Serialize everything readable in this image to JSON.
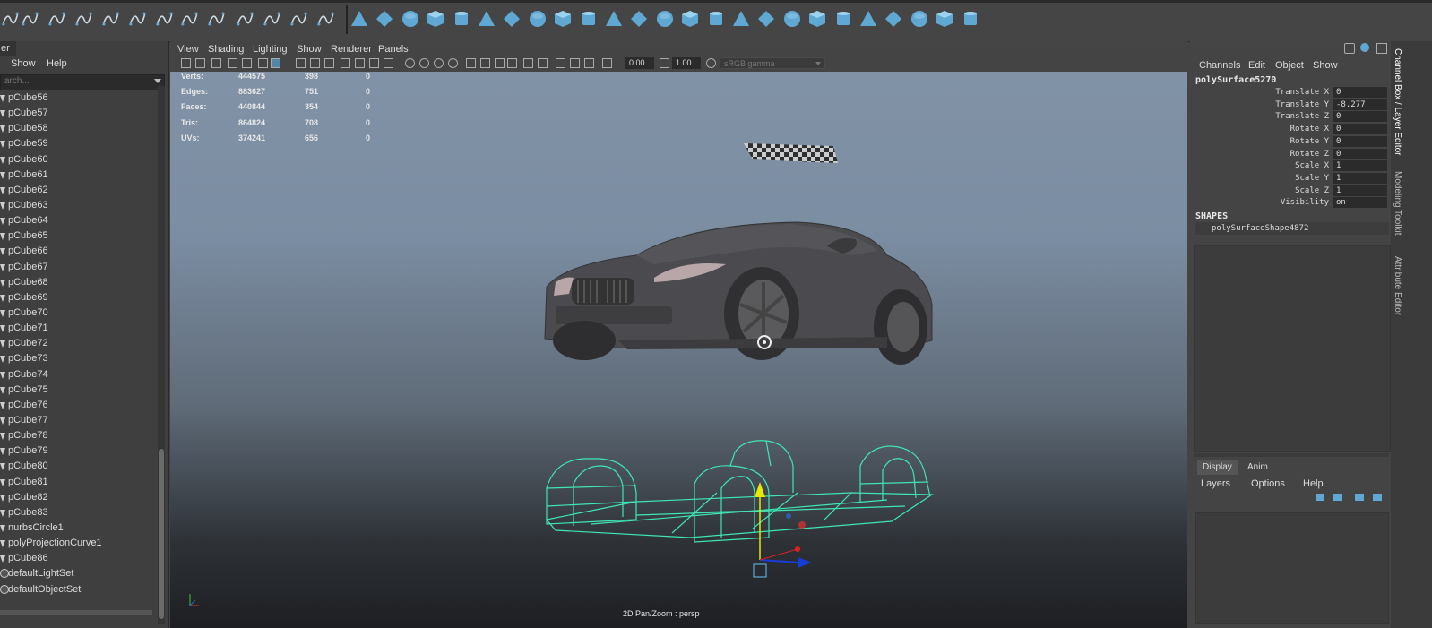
{
  "shelf": {
    "icons": [
      "select-curve-icon",
      "ep-curve-icon",
      "pencil-curve-icon",
      "bezier-curve-icon",
      "arc-icon",
      "curve-bend-icon",
      "curve-tool-icon",
      "curve-spiral-icon",
      "curve-zigzag-icon",
      "circle-arc-icon",
      "curve-points-icon",
      "curve-stroke-icon",
      "curve-rebuild-icon",
      "curve-edit-icon",
      "sphere-icon",
      "cube-icon",
      "cylinder-icon",
      "cone-icon",
      "plane-icon",
      "torus-icon",
      "pipe-icon",
      "helix-icon",
      "sphere-platonic-icon",
      "nurbs-cylinder-icon",
      "nurbs-plane-icon",
      "cube-open-icon",
      "cube-boolean-icon",
      "boolean-union-icon",
      "boolean-difference-icon",
      "boolean-intersect-icon",
      "extrude-icon",
      "bevel-icon",
      "bridge-icon",
      "append-icon",
      "merge-icon",
      "multi-cut-icon",
      "combine-icon",
      "smooth-icon"
    ]
  },
  "outliner": {
    "tab": "er",
    "menu": [
      "Show",
      "Help"
    ],
    "search_placeholder": "arch...",
    "items": [
      {
        "label": "pCube56",
        "type": "mesh"
      },
      {
        "label": "pCube57",
        "type": "mesh"
      },
      {
        "label": "pCube58",
        "type": "mesh"
      },
      {
        "label": "pCube59",
        "type": "mesh"
      },
      {
        "label": "pCube60",
        "type": "mesh"
      },
      {
        "label": "pCube61",
        "type": "mesh"
      },
      {
        "label": "pCube62",
        "type": "mesh"
      },
      {
        "label": "pCube63",
        "type": "mesh"
      },
      {
        "label": "pCube64",
        "type": "mesh"
      },
      {
        "label": "pCube65",
        "type": "mesh"
      },
      {
        "label": "pCube66",
        "type": "mesh"
      },
      {
        "label": "pCube67",
        "type": "mesh"
      },
      {
        "label": "pCube68",
        "type": "mesh"
      },
      {
        "label": "pCube69",
        "type": "mesh"
      },
      {
        "label": "pCube70",
        "type": "mesh"
      },
      {
        "label": "pCube71",
        "type": "mesh"
      },
      {
        "label": "pCube72",
        "type": "mesh"
      },
      {
        "label": "pCube73",
        "type": "mesh"
      },
      {
        "label": "pCube74",
        "type": "mesh"
      },
      {
        "label": "pCube75",
        "type": "mesh"
      },
      {
        "label": "pCube76",
        "type": "mesh"
      },
      {
        "label": "pCube77",
        "type": "mesh"
      },
      {
        "label": "pCube78",
        "type": "mesh"
      },
      {
        "label": "pCube79",
        "type": "mesh"
      },
      {
        "label": "pCube80",
        "type": "mesh"
      },
      {
        "label": "pCube81",
        "type": "mesh"
      },
      {
        "label": "pCube82",
        "type": "mesh"
      },
      {
        "label": "pCube83",
        "type": "mesh"
      },
      {
        "label": "nurbsCircle1",
        "type": "curve"
      },
      {
        "label": "polyProjectionCurve1",
        "type": "curve"
      },
      {
        "label": "pCube86",
        "type": "mesh"
      },
      {
        "label": "defaultLightSet",
        "type": "set"
      },
      {
        "label": "defaultObjectSet",
        "type": "set"
      }
    ]
  },
  "viewport": {
    "menu": [
      "View",
      "Shading",
      "Lighting",
      "Show",
      "Renderer",
      "Panels"
    ],
    "field1": "0.00",
    "field2": "1.00",
    "color_space": "sRGB gamma",
    "hud": [
      {
        "label": "Verts:",
        "a": "444575",
        "b": "398",
        "c": "0"
      },
      {
        "label": "Edges:",
        "a": "883627",
        "b": "751",
        "c": "0"
      },
      {
        "label": "Faces:",
        "a": "440844",
        "b": "354",
        "c": "0"
      },
      {
        "label": "Tris:",
        "a": "864824",
        "b": "708",
        "c": "0"
      },
      {
        "label": "UVs:",
        "a": "374241",
        "b": "656",
        "c": "0"
      }
    ],
    "camera_label": "2D Pan/Zoom : persp",
    "colors": {
      "wireframe": "#3fe6b4",
      "car": "#4c4c50",
      "accent": "#5fa8d3"
    }
  },
  "channel_box": {
    "menu": [
      "Channels",
      "Edit",
      "Object",
      "Show"
    ],
    "object": "polySurface5270",
    "attributes": [
      {
        "name": "Translate X",
        "value": "0"
      },
      {
        "name": "Translate Y",
        "value": "-8.277"
      },
      {
        "name": "Translate Z",
        "value": "0"
      },
      {
        "name": "Rotate X",
        "value": "0"
      },
      {
        "name": "Rotate Y",
        "value": "0"
      },
      {
        "name": "Rotate Z",
        "value": "0"
      },
      {
        "name": "Scale X",
        "value": "1"
      },
      {
        "name": "Scale Y",
        "value": "1"
      },
      {
        "name": "Scale Z",
        "value": "1"
      },
      {
        "name": "Visibility",
        "value": "on"
      }
    ],
    "shapes_label": "SHAPES",
    "shape": "polySurfaceShape4872",
    "layer_tabs": [
      "Display",
      "Anim"
    ],
    "layer_menu": [
      "Layers",
      "Options",
      "Help"
    ]
  },
  "side_tabs": [
    "Channel Box / Layer Editor",
    "Modeling Toolkit",
    "Attribute Editor"
  ]
}
